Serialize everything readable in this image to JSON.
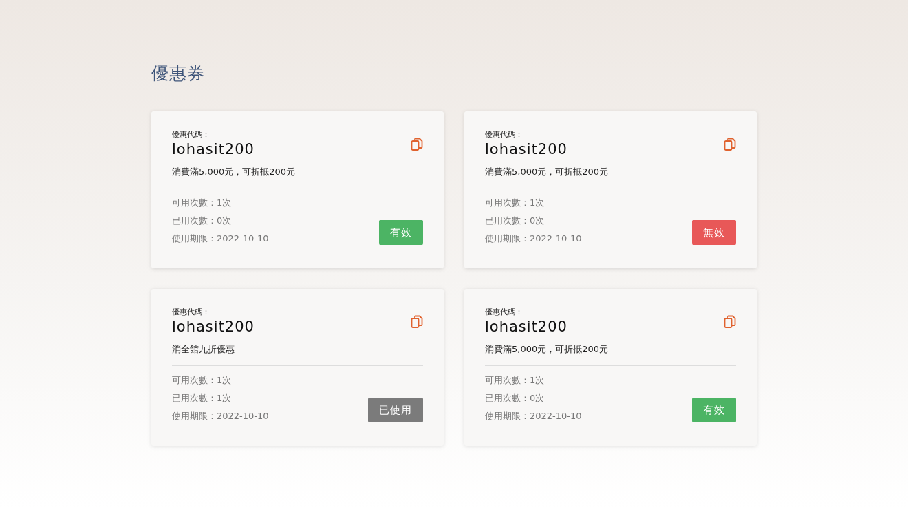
{
  "page_title": "優惠券",
  "coupons": [
    {
      "code_label": "優惠代碼：",
      "code": "lohasit200",
      "description": "消費滿5,000元，可折抵200元",
      "available_uses": "可用次數：1次",
      "used_count": "已用次數：0次",
      "expiry": "使用期限：2022-10-10",
      "kind": "valid",
      "status_label": "有效"
    },
    {
      "code_label": "優惠代碼：",
      "code": "lohasit200",
      "description": "消費滿5,000元，可折抵200元",
      "available_uses": "可用次數：1次",
      "used_count": "已用次數：0次",
      "expiry": "使用期限：2022-10-10",
      "kind": "invalid",
      "status_label": "無效"
    },
    {
      "code_label": "優惠代碼：",
      "code": "lohasit200",
      "description": "消全館九折優惠",
      "available_uses": "可用次數：1次",
      "used_count": "已用次數：1次",
      "expiry": "使用期限：2022-10-10",
      "kind": "used",
      "status_label": "已使用"
    },
    {
      "code_label": "優惠代碼：",
      "code": "lohasit200",
      "description": "消費滿5,000元，可折抵200元",
      "available_uses": "可用次數：1次",
      "used_count": "已用次數：0次",
      "expiry": "使用期限：2022-10-10",
      "kind": "valid",
      "status_label": "有效"
    }
  ]
}
